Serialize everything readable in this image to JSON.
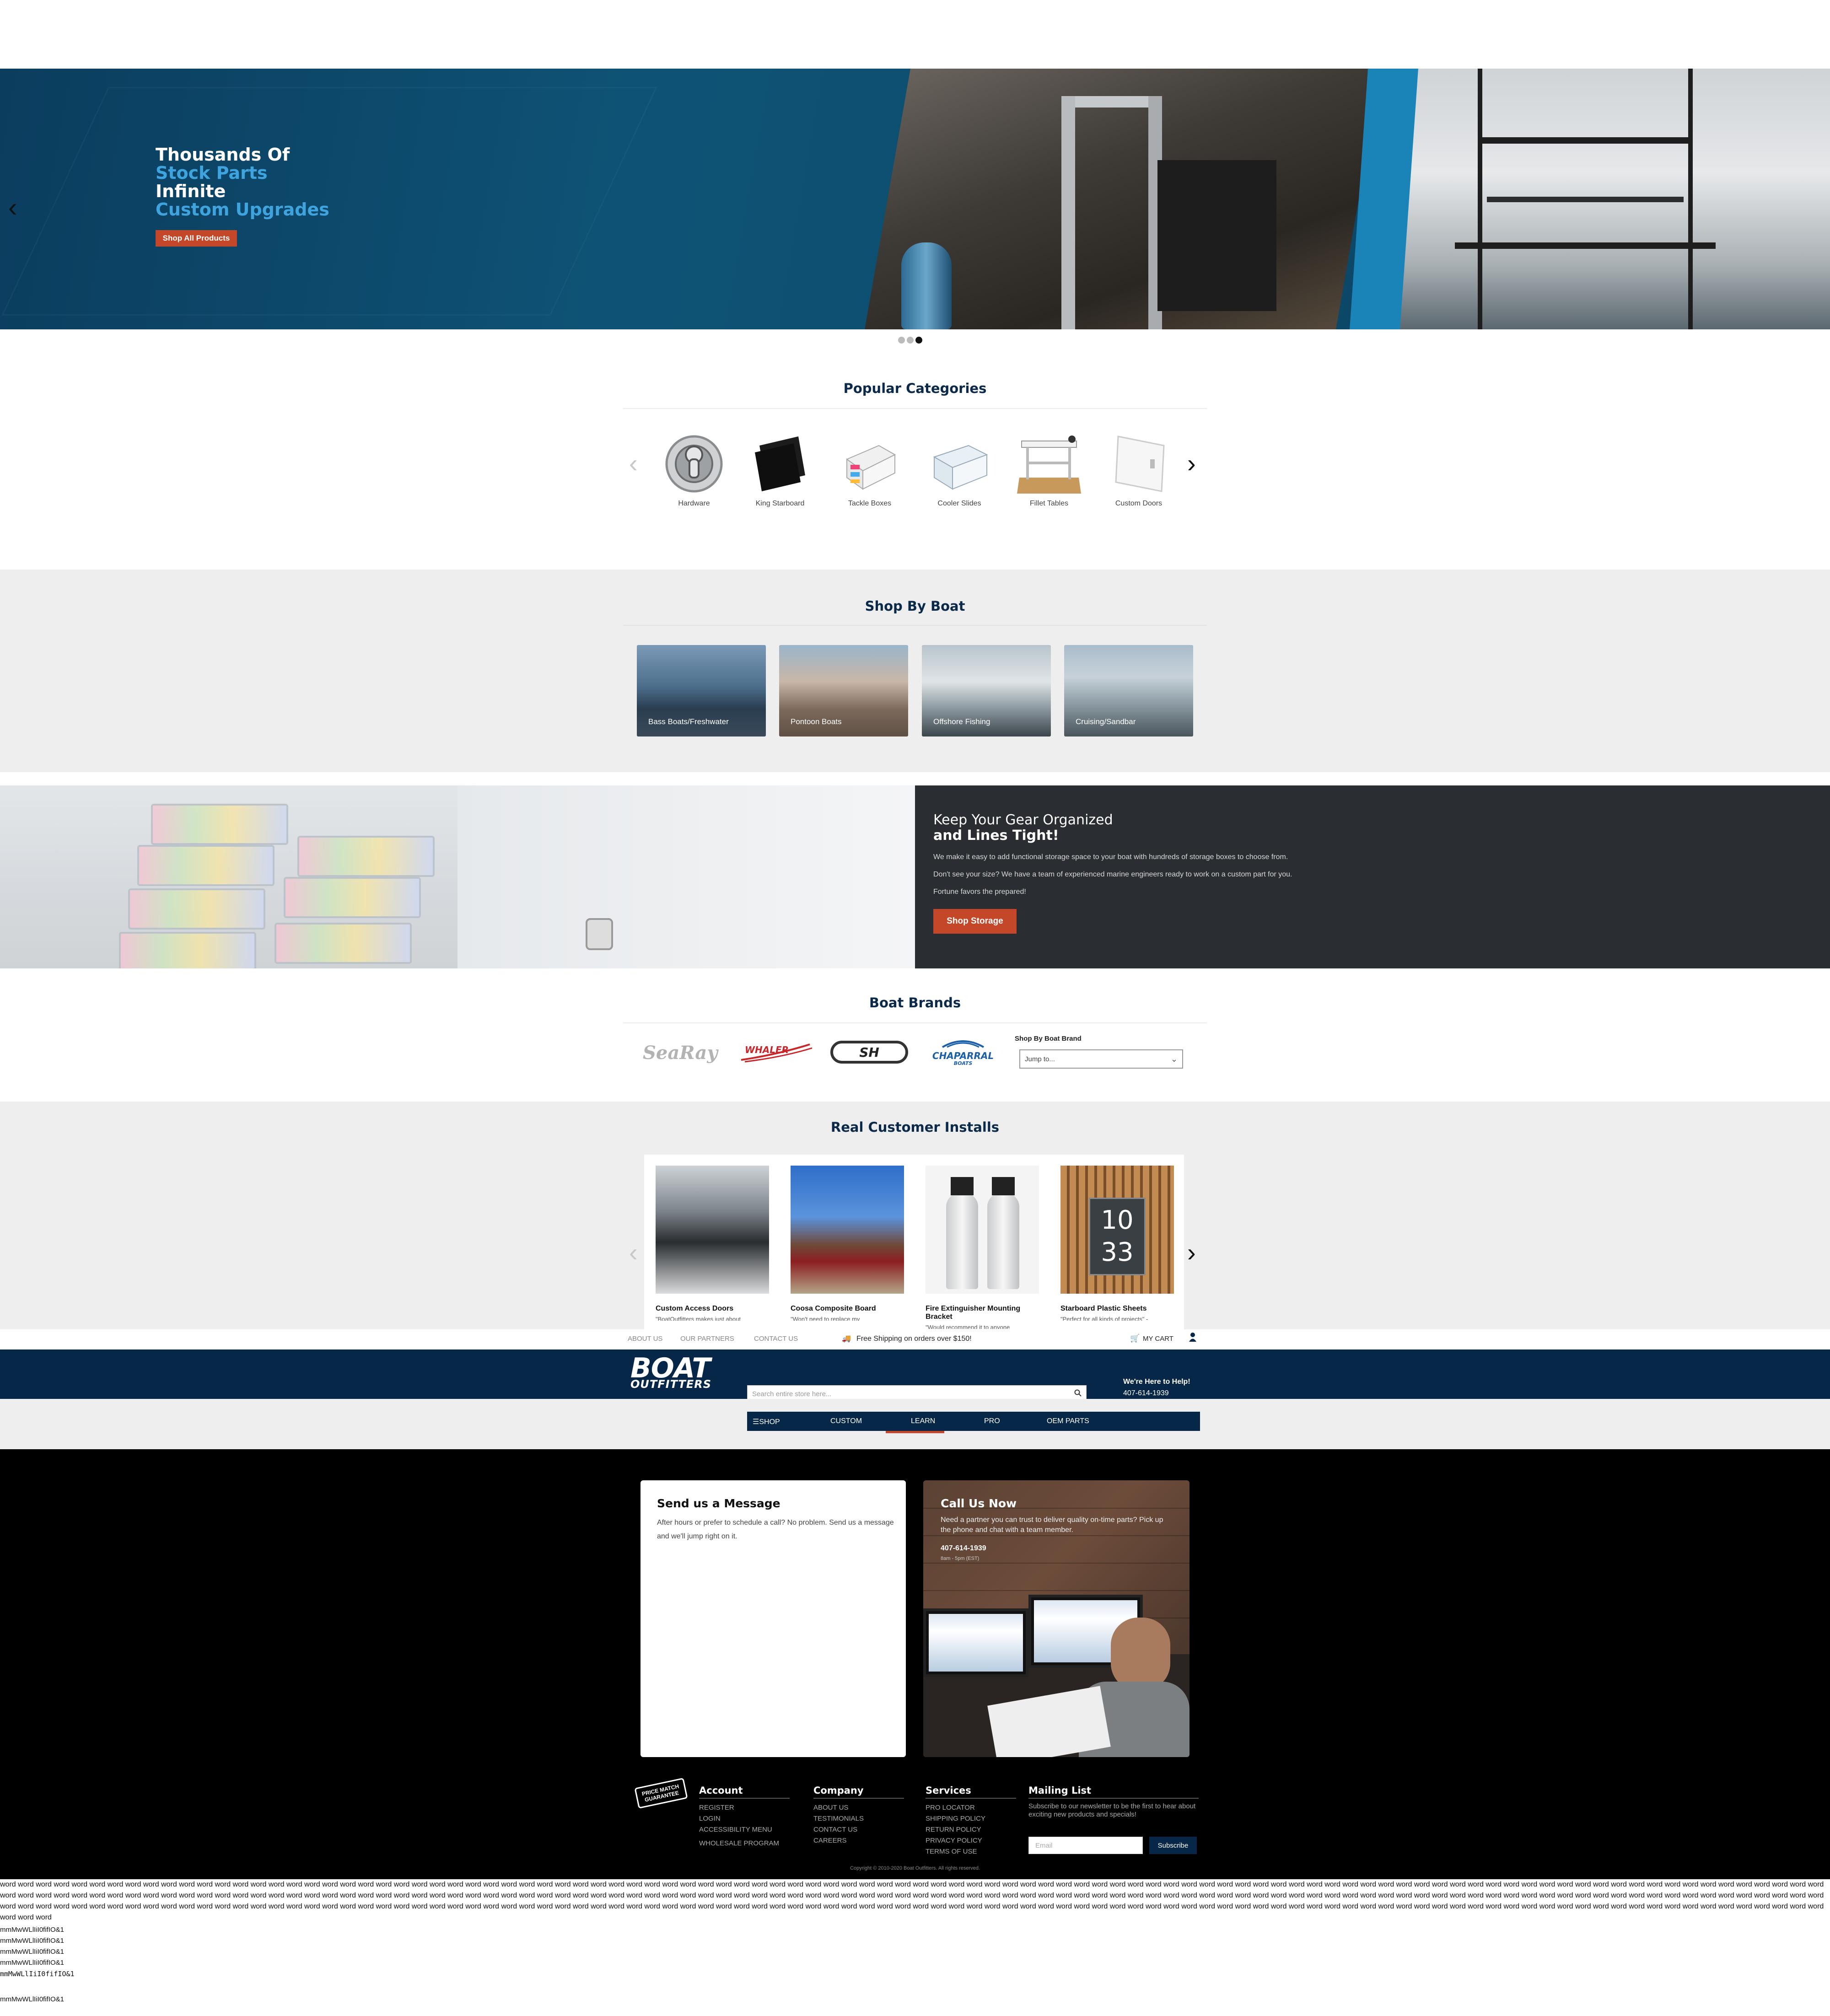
{
  "hero": {
    "line1": "Thousands Of",
    "line2": "Stock Parts",
    "line3": "Infinite",
    "line4": "Custom Upgrades",
    "button": "Shop All Products",
    "prev": "‹",
    "next": "›",
    "slides": 3,
    "active_slide": 3
  },
  "categories": {
    "title": "Popular Categories",
    "items": [
      "Hardware",
      "King Starboard",
      "Tackle Boxes",
      "Cooler Slides",
      "Fillet Tables",
      "Custom Doors"
    ]
  },
  "shop_by_boat": {
    "title": "Shop By Boat",
    "items": [
      "Bass Boats/Freshwater",
      "Pontoon Boats",
      "Offshore Fishing",
      "Cruising/Sandbar"
    ]
  },
  "storage": {
    "heading1": "Keep Your Gear Organized",
    "heading2": "and Lines Tight!",
    "p1": "We make it easy to add functional storage space to your boat with hundreds of storage boxes to choose from.",
    "p2": "Don't see your size? We have a team of experienced marine engineers ready to work on a custom part for you.",
    "p3": "Fortune favors the prepared!",
    "button": "Shop Storage"
  },
  "brands": {
    "title": "Boat Brands",
    "logos": [
      "SeaRay",
      "WHALER",
      "SH",
      "CHAPARRAL",
      "BOATS"
    ],
    "jump_label": "Shop By Boat Brand",
    "jump_value": "Jump to..."
  },
  "installs": {
    "title": "Real Customer Installs",
    "items": [
      {
        "title": "Custom Access Doors",
        "quote": "\"BoatOutfitters makes just about"
      },
      {
        "title": "Coosa Composite Board",
        "quote": "\"Won't need to replace my"
      },
      {
        "title": "Fire Extinguisher Mounting Bracket",
        "quote": "\"Would recommend it to anyone"
      },
      {
        "title": "Starboard Plastic Sheets",
        "quote": "\"Perfect for all kinds of projects\" -"
      }
    ],
    "sign_number": "10 33"
  },
  "topbar": {
    "links": [
      "ABOUT US",
      "OUR PARTNERS",
      "CONTACT US"
    ],
    "shipping": "Free Shipping on orders over $150!",
    "cart": "MY CART"
  },
  "header": {
    "logo_top": "BOAT",
    "logo_bottom": "OUTFITTERS",
    "search_placeholder": "Search entire store here...",
    "help_title": "We're Here to Help!",
    "phone": "407-614-1939"
  },
  "nav": {
    "items": [
      "SHOP",
      "CUSTOM",
      "LEARN",
      "PRO",
      "OEM PARTS"
    ]
  },
  "contact": {
    "message_title": "Send us a Message",
    "message_text": "After hours or prefer to schedule a call? No problem. Send us a message and we'll jump right on it.",
    "call_title": "Call Us Now",
    "call_text": "Need a partner you can trust to deliver quality on-time parts? Pick up the phone and chat with a team member.",
    "call_phone": "407-614-1939",
    "call_hours": "8am - 5pm (EST)"
  },
  "footer": {
    "badge": "PRICE MATCH GUARANTEE",
    "account": {
      "title": "Account",
      "links": [
        "REGISTER",
        "LOGIN",
        "ACCESSIBILITY MENU",
        "WHOLESALE PROGRAM"
      ]
    },
    "company": {
      "title": "Company",
      "links": [
        "ABOUT US",
        "TESTIMONIALS",
        "CONTACT US",
        "CAREERS"
      ]
    },
    "services": {
      "title": "Services",
      "links": [
        "PRO LOCATOR",
        "SHIPPING POLICY",
        "RETURN POLICY",
        "PRIVACY POLICY",
        "TERMS OF USE"
      ]
    },
    "mailing": {
      "title": "Mailing List",
      "text": "Subscribe to our newsletter to be the first to hear about exciting new products and specials!",
      "email_placeholder": "Email",
      "button": "Subscribe"
    },
    "copyright": "Copyright © 2010-2020 Boat Outfitters. All rights reserved."
  },
  "test_text": {
    "words": "word word word word word word word word word word word word word word word word word word word word word word word word word word word word word word word word word word word word word word word word word word word word word word word word word word word word word word word word word word word word word word word word word word word word word word word word word word word word word word word word word word word word word word word word word word word word word word word word word word word word word word word word word word word word word word word word word word word word word word word word word word word word word word word word word word word word word word word word word word word word word word word word word word word word word word word word word word word word word word word word word word word word word word word word word word word word word word word word word word word word word word word word word word word word word word word word word word word word word word word word word word word word word word word word word word word word word word word word word word word word word word word word word word word word word word word word word word word word word word word word word word word word word word word word word word word word word word word word word word word word word word word word word word word word word word word word word word word word word word word word word word word word word word word word word word word word word word word word word word word word word word word word word word word word word",
    "samples": [
      "mmMwWLlIiI0fifIO&1",
      "mmMwWLlIiI0fifIO&1",
      "mmMwWLlIiI0fifIO&1",
      "mmMwWLlIiI0fifIO&1",
      "mmMwWLlIiI0fifIO&1",
      "mmMwWLlIiI0fifIO&1"
    ]
  }
}
